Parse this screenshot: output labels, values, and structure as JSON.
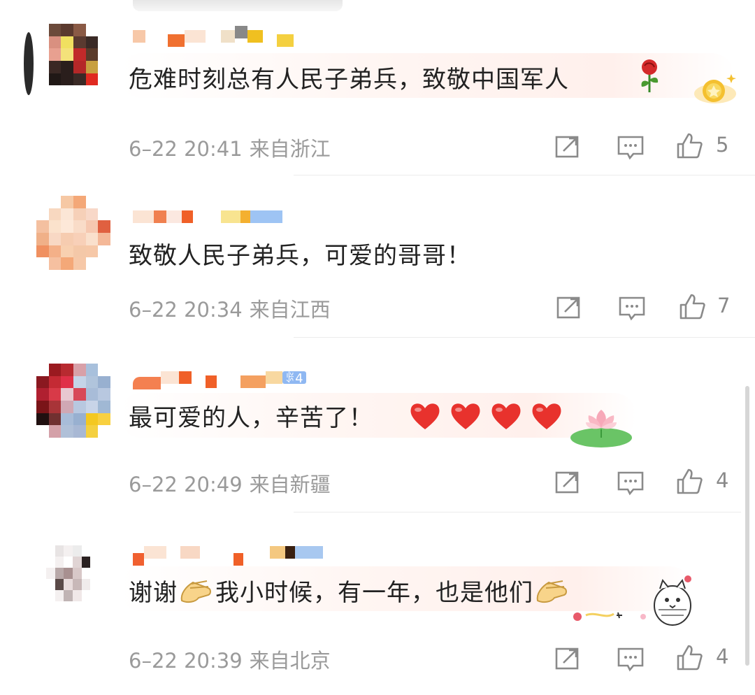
{
  "comments": [
    {
      "text": "危难时刻总有人民子弟兵，致敬中国军人",
      "time": "6–22 20:41",
      "location": "来自浙江",
      "likes": "5"
    },
    {
      "text": "致敬人民子弟兵，可爱的哥哥！",
      "time": "6–22 20:34",
      "location": "来自江西",
      "likes": "7"
    },
    {
      "text": "最可爱的人，辛苦了！",
      "time": "6–22 20:49",
      "location": "来自新疆",
      "likes": "4",
      "badge": "ꎀ4"
    },
    {
      "text": "谢谢",
      "text2": "我小时候，有一年，也是他们",
      "time": "6–22 20:39",
      "location": "来自北京",
      "likes": "4"
    }
  ],
  "icons": {
    "repost": "repost-icon",
    "comment": "comment-icon",
    "like": "thumbs-up-icon",
    "rose": "rose-emoji-icon",
    "heart": "heart-emoji-icon",
    "clap": "clap-emoji-icon",
    "lotus": "lotus-sticker-icon",
    "cat": "cat-sticker-icon",
    "medal": "medal-badge-icon"
  },
  "colors": {
    "text": "#222222",
    "meta": "#9a9a9a",
    "heart": "#e8322d",
    "badge": "#8fb8f2"
  }
}
